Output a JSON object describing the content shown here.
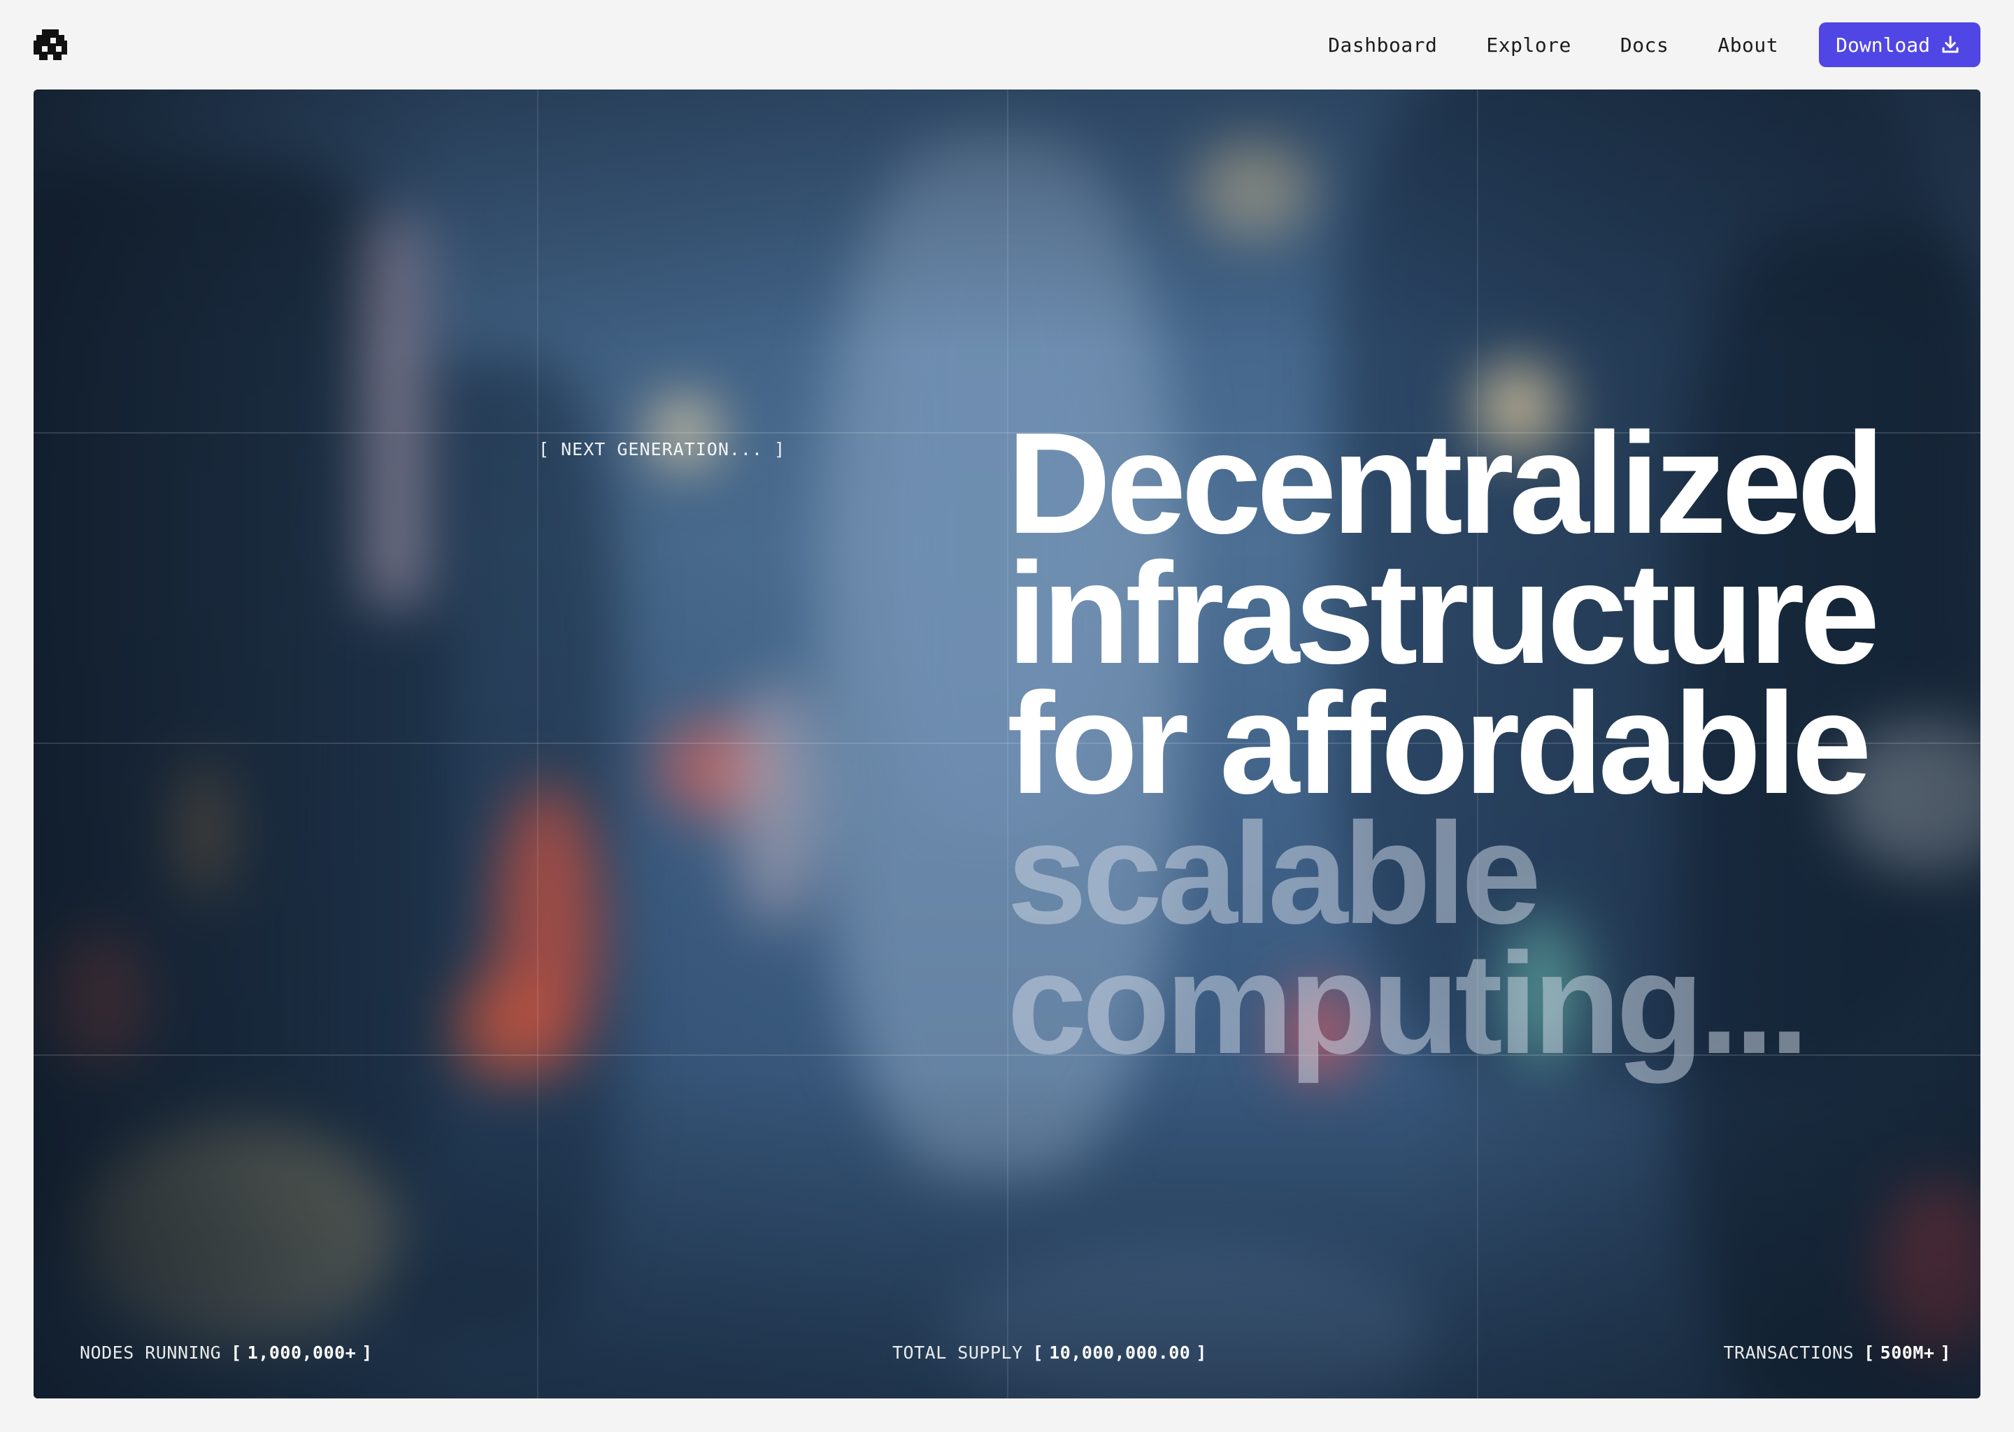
{
  "header": {
    "logo_icon": "pixel-logo-icon",
    "nav": {
      "dashboard": "Dashboard",
      "explore": "Explore",
      "docs": "Docs",
      "about": "About"
    },
    "download_label": "Download",
    "download_icon": "download-icon",
    "accent_color": "#5046e5"
  },
  "hero": {
    "tagline": "[ NEXT GENERATION... ]",
    "headline": {
      "line1": "Decentralized",
      "line2": "infrastructure",
      "line3": "for affordable",
      "line4": "scalable",
      "line5": "computing..."
    },
    "stats": {
      "nodes": {
        "label": "NODES RUNNING",
        "value": "1,000,000+"
      },
      "supply": {
        "label": "TOTAL SUPPLY",
        "value": "10,000,000.00"
      },
      "transactions": {
        "label": "TRANSACTIONS",
        "value": "500M+"
      }
    }
  }
}
